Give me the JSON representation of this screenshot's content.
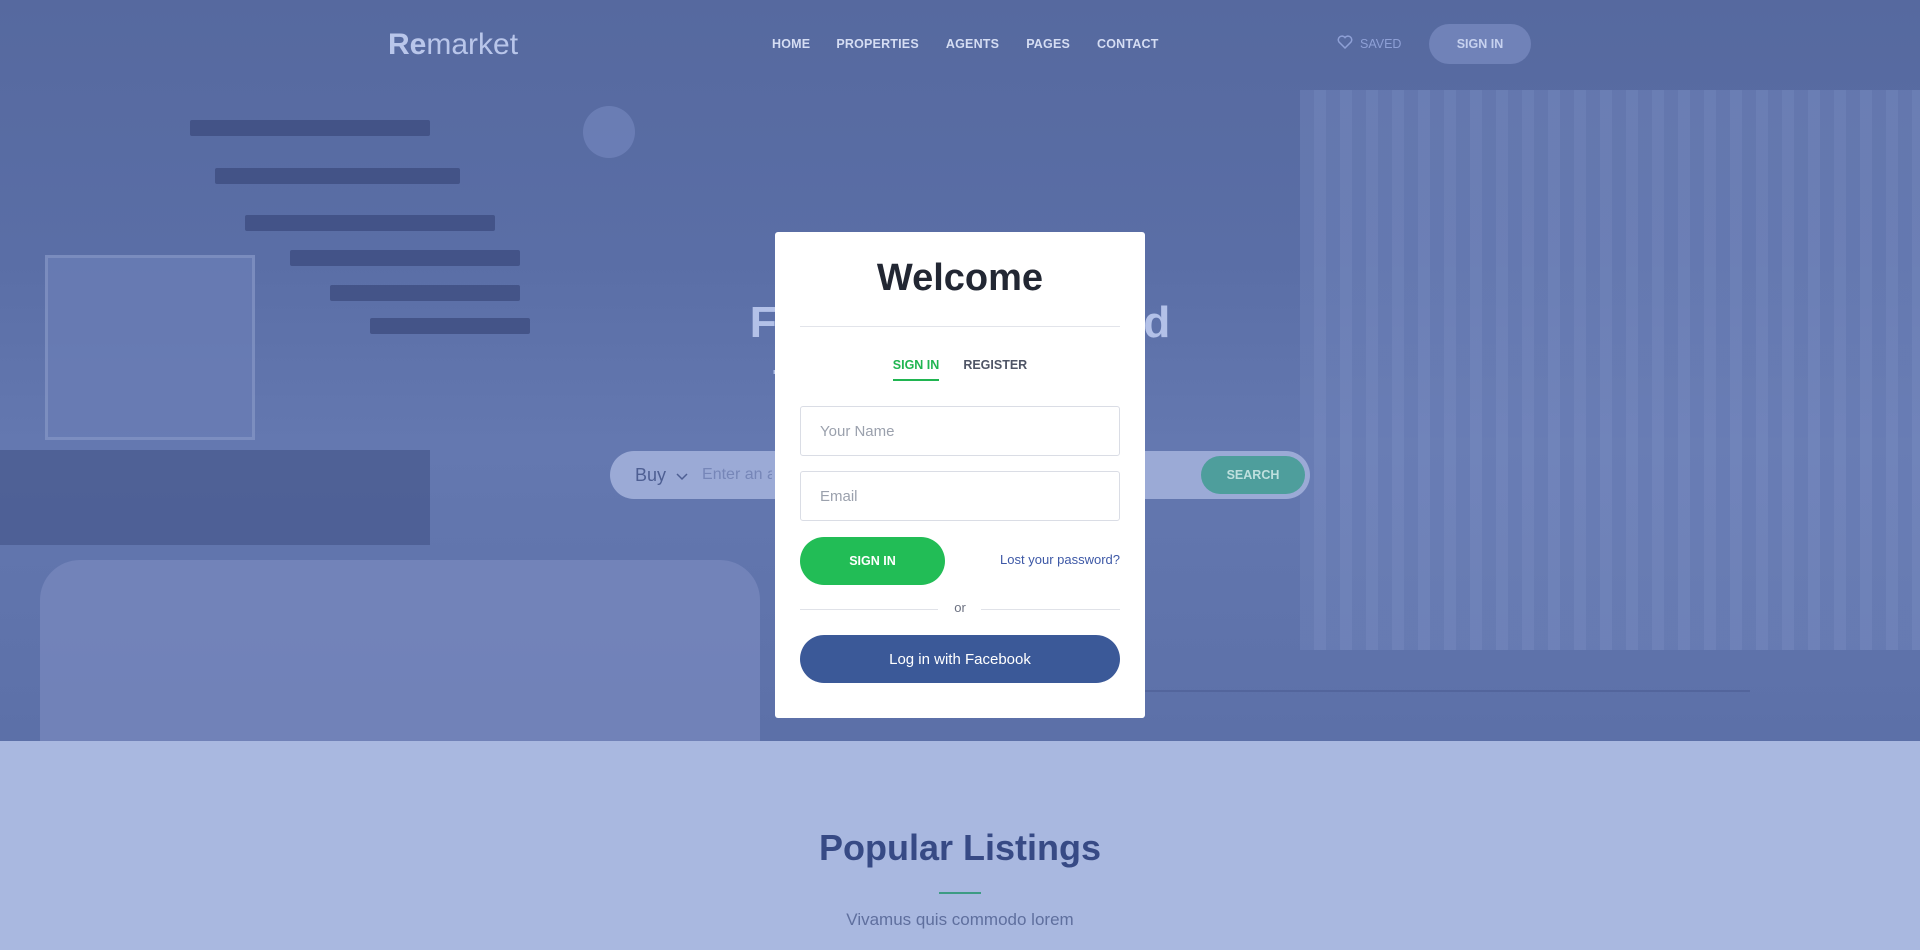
{
  "nav": {
    "logo_bold": "Re",
    "logo_light": "market",
    "menu": [
      "HOME",
      "PROPERTIES",
      "AGENTS",
      "PAGES",
      "CONTACT"
    ],
    "saved_label": "SAVED",
    "signin_label": "SIGN IN"
  },
  "hero": {
    "title_line1": "Find your home and",
    "title_line2": "the neighborhood",
    "search": {
      "type_selected": "Buy",
      "placeholder": "Enter an address",
      "button": "SEARCH"
    }
  },
  "modal": {
    "title": "Welcome",
    "tabs": [
      "SIGN IN",
      "REGISTER"
    ],
    "name_placeholder": "Your Name",
    "email_placeholder": "Email",
    "signin_button": "SIGN IN",
    "lost_password": "Lost your password?",
    "or": "or",
    "facebook_button": "Log in with Facebook"
  },
  "listings": {
    "title": "Popular Listings",
    "subtitle": "Vivamus quis commodo lorem"
  },
  "colors": {
    "accent_green": "#22bd56",
    "facebook_blue": "#3b5998",
    "hero_overlay": "#5a6ea6"
  }
}
